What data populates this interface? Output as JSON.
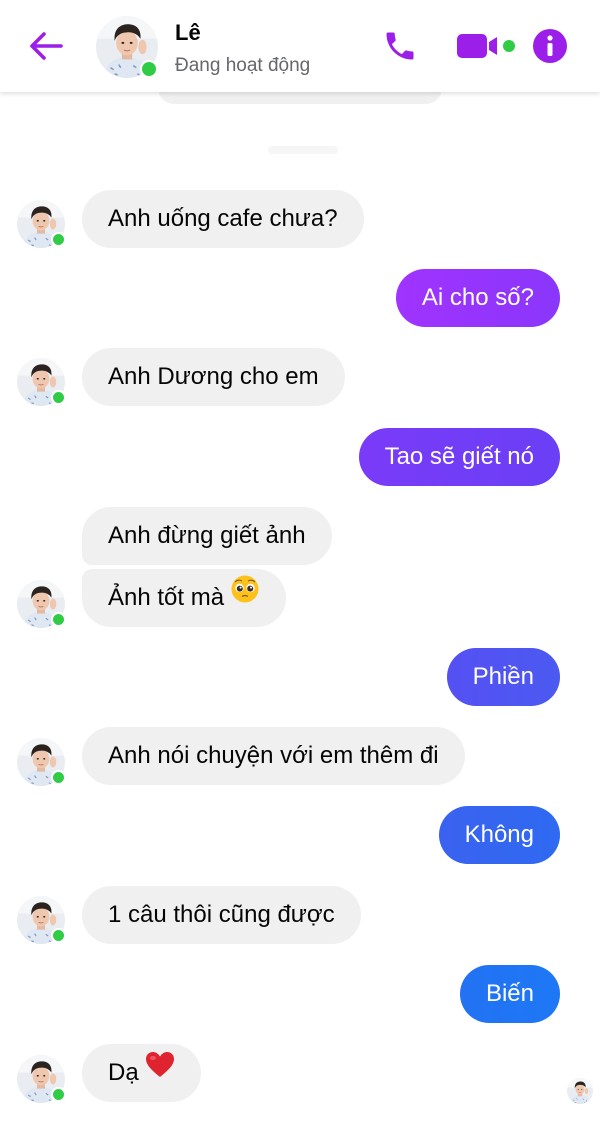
{
  "header": {
    "contact_name": "Lê",
    "status": "Đang hoạt động",
    "back_icon": "arrow-left-icon",
    "call_icon": "phone-icon",
    "video_icon": "video-camera-icon",
    "info_icon": "info-icon"
  },
  "colors": {
    "accent": "#9b1fe8",
    "online": "#31cc46",
    "incoming_bubble": "#f0f0f0",
    "outgoing_gradient": [
      "#a033ff",
      "#6b3cf5",
      "#3f63f0",
      "#1e78f5"
    ]
  },
  "messages": [
    {
      "text": "Anh uống cafe chưa?",
      "direction": "in"
    },
    {
      "text": "Ai cho số?",
      "direction": "out"
    },
    {
      "text": "Anh Dương cho em",
      "direction": "in"
    },
    {
      "text": "Tao sẽ giết nó",
      "direction": "out"
    },
    {
      "text": "Anh đừng giết ảnh",
      "direction": "in"
    },
    {
      "text": "Ảnh tốt mà",
      "direction": "in",
      "emoji": "pleading-face-emoji"
    },
    {
      "text": "Phiền",
      "direction": "out"
    },
    {
      "text": "Anh nói chuyện với em thêm đi",
      "direction": "in"
    },
    {
      "text": "Không",
      "direction": "out"
    },
    {
      "text": "1 câu thôi cũng được",
      "direction": "in"
    },
    {
      "text": "Biến",
      "direction": "out"
    },
    {
      "text": "Dạ",
      "direction": "in",
      "emoji": "red-heart-emoji"
    }
  ]
}
